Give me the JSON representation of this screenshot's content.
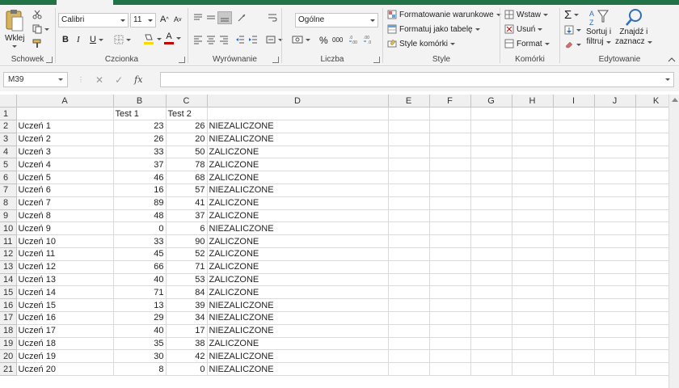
{
  "ribbon": {
    "clipboard": {
      "paste_label": "Wklej",
      "group_label": "Schowek"
    },
    "font": {
      "font_name": "Calibri",
      "font_size": "11",
      "group_label": "Czcionka",
      "bold": "B",
      "italic": "I",
      "underline": "U",
      "grow": "A",
      "shrink": "A",
      "font_color_letter": "A"
    },
    "alignment": {
      "group_label": "Wyrównanie"
    },
    "number": {
      "format": "Ogólne",
      "group_label": "Liczba",
      "percent": "%",
      "thousands": "000"
    },
    "styles": {
      "conditional": "Formatowanie warunkowe",
      "as_table": "Formatuj jako tabelę",
      "cell_styles": "Style komórki",
      "group_label": "Style"
    },
    "cells": {
      "insert": "Wstaw",
      "delete": "Usuń",
      "format": "Format",
      "group_label": "Komórki"
    },
    "editing": {
      "sort_line1": "Sortuj i",
      "sort_line2": "filtruj",
      "find_line1": "Znajdź i",
      "find_line2": "zaznacz",
      "group_label": "Edytowanie"
    }
  },
  "formula_bar": {
    "name_box": "M39",
    "fx": "fx",
    "value": ""
  },
  "sheet": {
    "columns": [
      "A",
      "B",
      "C",
      "D",
      "E",
      "F",
      "G",
      "H",
      "I",
      "J",
      "K"
    ],
    "rows": [
      [
        "",
        "Test 1",
        "Test 2",
        ""
      ],
      [
        "Uczeń 1",
        "23",
        "26",
        "NIEZALICZONE"
      ],
      [
        "Uczeń 2",
        "26",
        "20",
        "NIEZALICZONE"
      ],
      [
        "Uczeń 3",
        "33",
        "50",
        "ZALICZONE"
      ],
      [
        "Uczeń 4",
        "37",
        "78",
        "ZALICZONE"
      ],
      [
        "Uczeń 5",
        "46",
        "68",
        "ZALICZONE"
      ],
      [
        "Uczeń 6",
        "16",
        "57",
        "NIEZALICZONE"
      ],
      [
        "Uczeń 7",
        "89",
        "41",
        "ZALICZONE"
      ],
      [
        "Uczeń 8",
        "48",
        "37",
        "ZALICZONE"
      ],
      [
        "Uczeń 9",
        "0",
        "6",
        "NIEZALICZONE"
      ],
      [
        "Uczeń 10",
        "33",
        "90",
        "ZALICZONE"
      ],
      [
        "Uczeń 11",
        "45",
        "52",
        "ZALICZONE"
      ],
      [
        "Uczeń 12",
        "66",
        "71",
        "ZALICZONE"
      ],
      [
        "Uczeń 13",
        "40",
        "53",
        "ZALICZONE"
      ],
      [
        "Uczeń 14",
        "71",
        "84",
        "ZALICZONE"
      ],
      [
        "Uczeń 15",
        "13",
        "39",
        "NIEZALICZONE"
      ],
      [
        "Uczeń 16",
        "29",
        "34",
        "NIEZALICZONE"
      ],
      [
        "Uczeń 17",
        "40",
        "17",
        "NIEZALICZONE"
      ],
      [
        "Uczeń 18",
        "35",
        "38",
        "ZALICZONE"
      ],
      [
        "Uczeń 19",
        "30",
        "42",
        "NIEZALICZONE"
      ],
      [
        "Uczeń 20",
        "8",
        "0",
        "NIEZALICZONE"
      ]
    ]
  },
  "colors": {
    "accent": "#217346",
    "font_color": "#c00000",
    "highlight": "#ffd800"
  }
}
